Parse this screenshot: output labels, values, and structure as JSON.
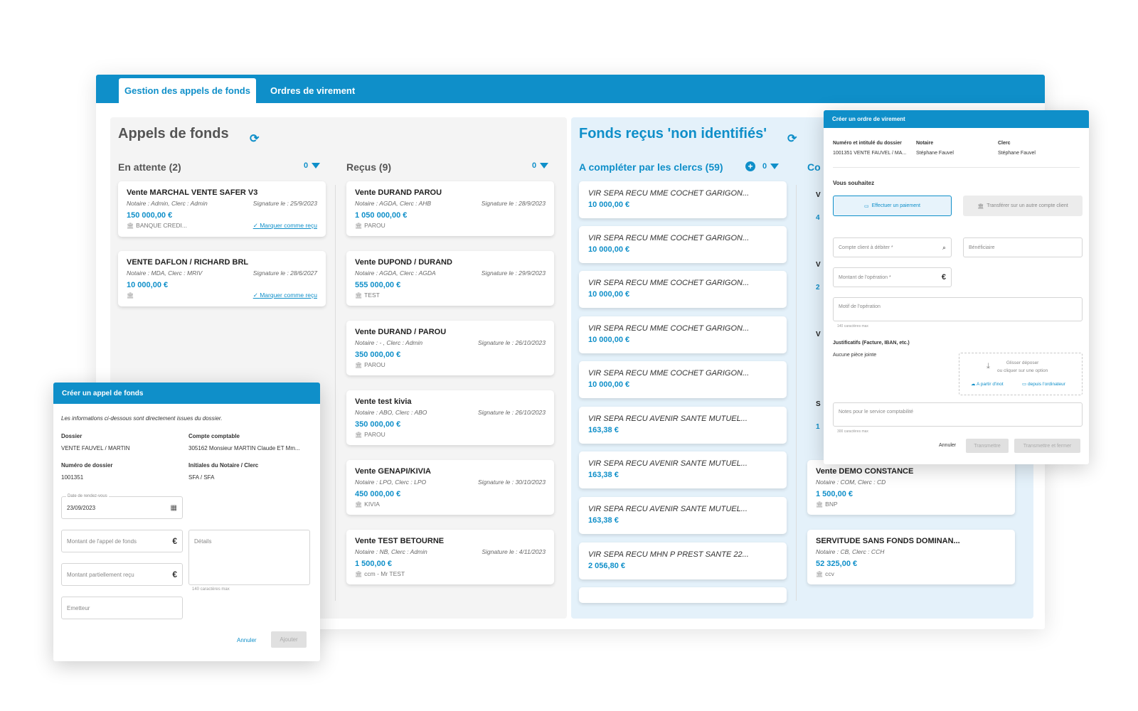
{
  "tabs": [
    {
      "label": "Gestion des appels de fonds"
    },
    {
      "label": "Ordres de virement"
    }
  ],
  "left_panel": {
    "title": "Appels de fonds",
    "col1": {
      "header": "En attente (2)",
      "filter_count": "0",
      "cards": [
        {
          "title": "Vente MARCHAL VENTE SAFER V3",
          "notaire": "Notaire : Admin, Clerc : Admin",
          "signature": "Signature le : 25/9/2023",
          "amount": "150 000,00 €",
          "bank": "BANQUE CREDI...",
          "action": "Marquer comme reçu"
        },
        {
          "title": "VENTE DAFLON / RICHARD BRL",
          "notaire": "Notaire : MDA, Clerc : MRIV",
          "signature": "Signature le : 28/6/2027",
          "amount": "10 000,00 €",
          "bank": "",
          "action": "Marquer comme reçu"
        }
      ]
    },
    "col2": {
      "header": "Reçus (9)",
      "filter_count": "0",
      "cards": [
        {
          "title": "Vente DURAND PAROU",
          "notaire": "Notaire : AGDA, Clerc : AHB",
          "signature": "Signature le : 28/9/2023",
          "amount": "1 050 000,00 €",
          "bank": "PAROU"
        },
        {
          "title": "Vente DUPOND / DURAND",
          "notaire": "Notaire : AGDA, Clerc : AGDA",
          "signature": "Signature le : 29/9/2023",
          "amount": "555 000,00 €",
          "bank": "TEST"
        },
        {
          "title": "Vente DURAND / PAROU",
          "notaire": "Notaire : - , Clerc : Admin",
          "signature": "Signature le : 26/10/2023",
          "amount": "350 000,00 €",
          "bank": "PAROU"
        },
        {
          "title": "Vente test kivia",
          "notaire": "Notaire : ABO, Clerc : ABO",
          "signature": "Signature le : 26/10/2023",
          "amount": "350 000,00 €",
          "bank": "PAROU"
        },
        {
          "title": "Vente GENAPI/KIVIA",
          "notaire": "Notaire : LPO, Clerc : LPO",
          "signature": "Signature le : 30/10/2023",
          "amount": "450 000,00 €",
          "bank": "KIVIA"
        },
        {
          "title": "Vente TEST BETOURNE",
          "notaire": "Notaire : NB, Clerc : Admin",
          "signature": "Signature le : 4/11/2023",
          "amount": "1 500,00 €",
          "bank": "ccm - Mr TEST"
        }
      ]
    }
  },
  "right_panel": {
    "title": "Fonds reçus 'non identifiés'",
    "col1": {
      "header": "A compléter par les clercs (59)",
      "filter_count": "0",
      "cards": [
        {
          "title": "VIR SEPA RECU MME COCHET GARIGON...",
          "amount": "10 000,00 €"
        },
        {
          "title": "VIR SEPA RECU MME COCHET GARIGON...",
          "amount": "10 000,00 €"
        },
        {
          "title": "VIR SEPA RECU MME COCHET GARIGON...",
          "amount": "10 000,00 €"
        },
        {
          "title": "VIR SEPA RECU MME COCHET GARIGON...",
          "amount": "10 000,00 €"
        },
        {
          "title": "VIR SEPA RECU MME COCHET GARIGON...",
          "amount": "10 000,00 €"
        },
        {
          "title": "VIR SEPA RECU AVENIR SANTE MUTUEL...",
          "amount": "163,38 €"
        },
        {
          "title": "VIR SEPA RECU AVENIR SANTE MUTUEL...",
          "amount": "163,38 €"
        },
        {
          "title": "VIR SEPA RECU AVENIR SANTE MUTUEL...",
          "amount": "163,38 €"
        },
        {
          "title": "VIR SEPA RECU MHN P PREST SANTE 22...",
          "amount": "2 056,80 €"
        }
      ]
    },
    "col2": {
      "header": "Co",
      "cards": [
        {
          "title": "Vente DEMO CONSTANCE",
          "notaire": "Notaire : COM, Clerc : CD",
          "amount": "1 500,00 €",
          "bank": "BNP"
        },
        {
          "title": "SERVITUDE SANS FONDS DOMINAN...",
          "notaire": "Notaire : CB, Clerc : CCH",
          "amount": "52 325,00 €",
          "bank": "ccv"
        }
      ],
      "peek_letters": [
        "V",
        "4",
        "V",
        "2",
        "V",
        "S",
        "1"
      ]
    }
  },
  "appel_dialog": {
    "title": "Créer un appel de fonds",
    "intro": "Les informations ci-dessous sont directement issues du dossier.",
    "dossier_label": "Dossier",
    "dossier_value": "VENTE FAUVEL / MARTIN",
    "compte_label": "Compte comptable",
    "compte_value": "305162  Monsieur MARTIN Claude ET Mm...",
    "numero_label": "Numéro de dossier",
    "numero_value": "1001351",
    "initiales_label": "Initiales du Notaire / Clerc",
    "initiales_value": "SFA / SFA",
    "date_label": "Date de rendez-vous",
    "date_value": "23/09/2023",
    "montant_placeholder": "Montant de l'appel de fonds",
    "partiel_placeholder": "Montant partiellement reçu",
    "details_placeholder": "Détails",
    "details_hint": "140 caractères max",
    "emetteur_placeholder": "Emetteur",
    "cancel": "Annuler",
    "submit": "Ajouter"
  },
  "virement_dialog": {
    "title": "Créer un ordre de virement",
    "numero_label": "Numéro et intitulé du dossier",
    "numero_value": "1001351 VENTE FAUVEL / MA...",
    "notaire_label": "Notaire",
    "notaire_value": "Stéphane Fauvel",
    "clerc_label": "Clerc",
    "clerc_value": "Stéphane Fauvel",
    "souhaitez": "Vous souhaitez",
    "opt_paiement": "Effectuer un paiement",
    "opt_transfert": "Transférer sur un autre compte client",
    "compte_placeholder": "Compte client à débiter *",
    "beneficiaire_placeholder": "Bénéficiaire",
    "montant_placeholder": "Montant de l'opération *",
    "motif_placeholder": "Motif de l'opération",
    "motif_hint": "140 caractères max",
    "justificatifs": "Justificatifs (Facture, IBAN, etc.)",
    "aucune": "Aucune pièce jointe",
    "drop_line1": "Glisser déposer",
    "drop_line2": "ou cliquer sur une option",
    "from_inot": "A partir d'inot",
    "from_pc": "depuis l'ordinateur",
    "notes_placeholder": "Notes pour le service comptabilité",
    "notes_hint": "300 caractères max",
    "cancel": "Annuler",
    "transmit": "Transmettre",
    "transmit_close": "Transmettre et fermer"
  }
}
